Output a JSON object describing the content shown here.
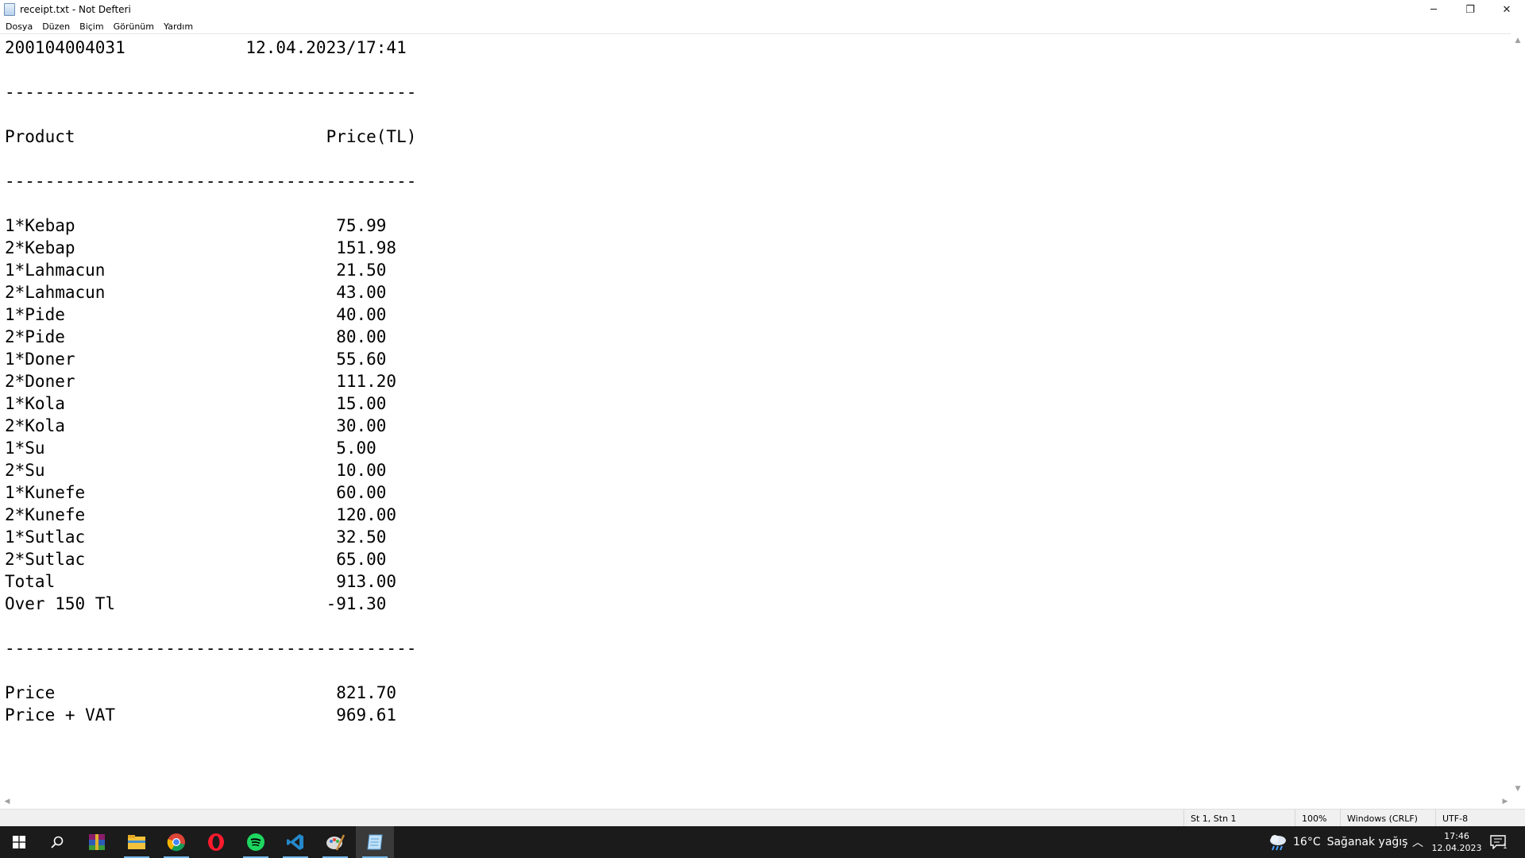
{
  "window": {
    "title": "receipt.txt - Not Defteri",
    "minimize_glyph": "─",
    "maximize_glyph": "❐",
    "close_glyph": "✕"
  },
  "menu": {
    "items": [
      {
        "label": "Dosya"
      },
      {
        "label": "Düzen"
      },
      {
        "label": "Biçim"
      },
      {
        "label": "Görünüm"
      },
      {
        "label": "Yardım"
      }
    ]
  },
  "document": {
    "lines": [
      "200104004031            12.04.2023/17:41",
      "",
      "-----------------------------------------",
      "",
      "Product                         Price(TL)",
      "",
      "-----------------------------------------",
      "",
      "1*Kebap                          75.99",
      "2*Kebap                          151.98",
      "1*Lahmacun                       21.50",
      "2*Lahmacun                       43.00",
      "1*Pide                           40.00",
      "2*Pide                           80.00",
      "1*Doner                          55.60",
      "2*Doner                          111.20",
      "1*Kola                           15.00",
      "2*Kola                           30.00",
      "1*Su                             5.00",
      "2*Su                             10.00",
      "1*Kunefe                         60.00",
      "2*Kunefe                         120.00",
      "1*Sutlac                         32.50",
      "2*Sutlac                         65.00",
      "Total                            913.00",
      "Over 150 Tl                     -91.30",
      "",
      "-----------------------------------------",
      "",
      "Price                            821.70",
      "Price + VAT                      969.61"
    ]
  },
  "statusbar": {
    "position": "St 1, Stn 1",
    "zoom": "100%",
    "line_ending": "Windows (CRLF)",
    "encoding": "UTF-8"
  },
  "taskbar": {
    "weather_temp": "16°C",
    "weather_text": "Sağanak yağış",
    "time": "17:46",
    "date": "12.04.2023",
    "notification_count": "1",
    "apps": [
      {
        "name": "winrar-icon"
      },
      {
        "name": "file-explorer-icon"
      },
      {
        "name": "chrome-icon"
      },
      {
        "name": "opera-icon"
      },
      {
        "name": "spotify-icon"
      },
      {
        "name": "vscode-icon"
      },
      {
        "name": "drawing-app-icon"
      },
      {
        "name": "notepad-icon"
      }
    ]
  },
  "colors": {
    "taskbar_bg": "#1b1b1b",
    "active_underline": "#76b9ed",
    "statusbar_bg": "#f0f0f0"
  }
}
